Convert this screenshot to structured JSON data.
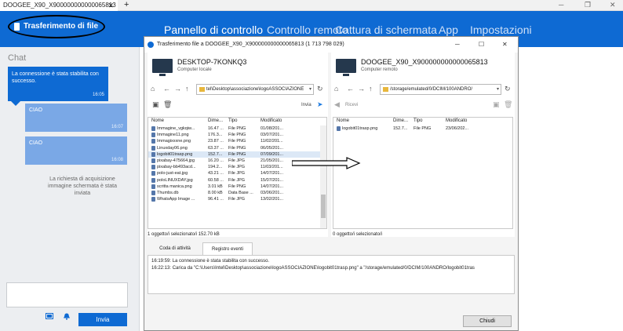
{
  "browser_tab": {
    "title": "DOOGEE_X90_X900000000000065813",
    "close": "✕",
    "new_tab": "+"
  },
  "window_controls": {
    "minimize": "─",
    "restore": "❐",
    "close": "✕"
  },
  "header": {
    "file_transfer_button": "Trasferimento di file",
    "nav": [
      "Pannello di controllo",
      "Controllo remoto",
      "Cattura di schermata",
      "App",
      "Impostazioni"
    ]
  },
  "chat": {
    "title": "Chat",
    "messages": [
      {
        "text": "La connessione è stata stabilita con successo.",
        "time": "16:05",
        "side": "in"
      },
      {
        "text": "CIAO",
        "time": "16:07",
        "side": "out"
      },
      {
        "text": "CIAO",
        "time": "16:08",
        "side": "out"
      }
    ],
    "status": "La richiesta di acquisizione immagine schermata è stata inviata",
    "input_value": "",
    "send_label": "Invia"
  },
  "transfer": {
    "title": "Trasferimento file a DOOGEE_X90_X900000000000065813 (1 713 798 029)",
    "local": {
      "name": "DESKTOP-7KONKQ3",
      "sub": "Computer locale",
      "path": "tel\\Desktop\\associazione\\logoASSOCIAZIONE",
      "action": "Invia",
      "columns": [
        "Nome",
        "Dime...",
        "Tipo",
        "Modificato"
      ],
      "files": [
        [
          "Immagine_vgkqiw...",
          "16.47 ...",
          "File PNG",
          "01/08/201..."
        ],
        [
          "Immagine11.png",
          "176.3...",
          "File PNG",
          "03/07/201..."
        ],
        [
          "Immagixxxne.png",
          "23.87 ...",
          "File PNG",
          "11/02/201..."
        ],
        [
          "Linuxday06.png",
          "63.37 ...",
          "File PNG",
          "06/05/201..."
        ],
        [
          "logobit01trasp.png",
          "152.7...",
          "File PNG",
          "07/09/201..."
        ],
        [
          "pixabay-475664.jpg",
          "16.20 ...",
          "File JPG",
          "21/05/201..."
        ],
        [
          "pixabay-bb493acd...",
          "194.2...",
          "File JPG",
          "11/03/201..."
        ],
        [
          "polo-just-eat.jpg",
          "43.21 ...",
          "File JPG",
          "14/07/201..."
        ],
        [
          "poloLINUXDAY.jpg",
          "60.58 ...",
          "File JPG",
          "15/07/201..."
        ],
        [
          "scritta manica.png",
          "3.01 kB",
          "File PNG",
          "14/07/201..."
        ],
        [
          "Thumbs.db",
          "8.00 kB",
          "Data Base ...",
          "03/06/201..."
        ],
        [
          "WhatsApp Image ...",
          "96.41 ...",
          "File JPG",
          "13/02/201..."
        ]
      ],
      "selected_index": 4,
      "status": "1 oggetto/i selezionato/i  152.70 kB"
    },
    "remote": {
      "name": "DOOGEE_X90_X900000000000065813",
      "sub": "Computer remoto",
      "path": "/storage/emulated/0/DCIM/100ANDRO/",
      "action": "Ricevi",
      "columns": [
        "Nome",
        "Dime...",
        "Tipo",
        "Modificato"
      ],
      "files": [
        [
          "logobit01trasp.png",
          "152.7...",
          "File PNG",
          "23/06/202..."
        ]
      ],
      "status": "0 oggetto/i selezionato/i"
    },
    "tabs": [
      "Coda di attività",
      "Registro eventi"
    ],
    "active_tab": "Registro eventi",
    "log": [
      "16:19:59: La connessione è stata stabilita con successo.",
      "16:22:13: Carica da \"C:\\Users\\Intel\\Desktop\\associazione\\logoASSOCIAZIONE\\logobit01trasp.png\" a \"/storage/emulated/0/DCIM/100ANDRO/logobit01tras"
    ],
    "close_label": "Chiudi"
  },
  "colors": {
    "accent": "#0e6ad3",
    "chat_out": "#7aa8e6",
    "selection": "#dce8f6"
  }
}
